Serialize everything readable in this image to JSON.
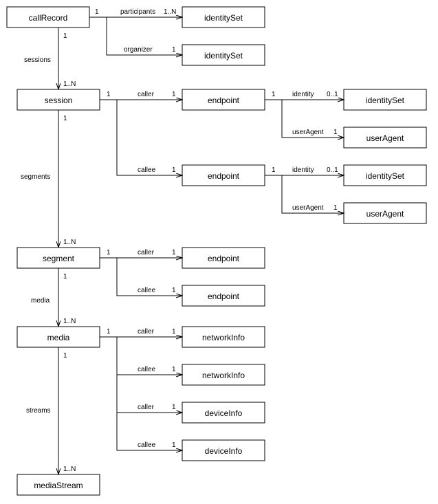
{
  "entities": {
    "callRecord": "callRecord",
    "identitySet1": "identitySet",
    "identitySet2": "identitySet",
    "session": "session",
    "endpoint1": "endpoint",
    "endpoint2": "endpoint",
    "identitySet3": "identitySet",
    "identitySet4": "identitySet",
    "userAgent1": "userAgent",
    "userAgent2": "userAgent",
    "segment": "segment",
    "endpoint3": "endpoint",
    "endpoint4": "endpoint",
    "media": "media",
    "networkInfo1": "networkInfo",
    "networkInfo2": "networkInfo",
    "deviceInfo1": "deviceInfo",
    "deviceInfo2": "deviceInfo",
    "mediaStream": "mediaStream"
  },
  "labels": {
    "participants": "participants",
    "organizer": "organizer",
    "sessions": "sessions",
    "caller": "caller",
    "callee": "callee",
    "identity": "identity",
    "userAgent": "userAgent",
    "segments": "segments",
    "media": "media",
    "streams": "streams"
  },
  "mult": {
    "one": "1",
    "oneN": "1..N",
    "zeroOne": "0..1"
  }
}
